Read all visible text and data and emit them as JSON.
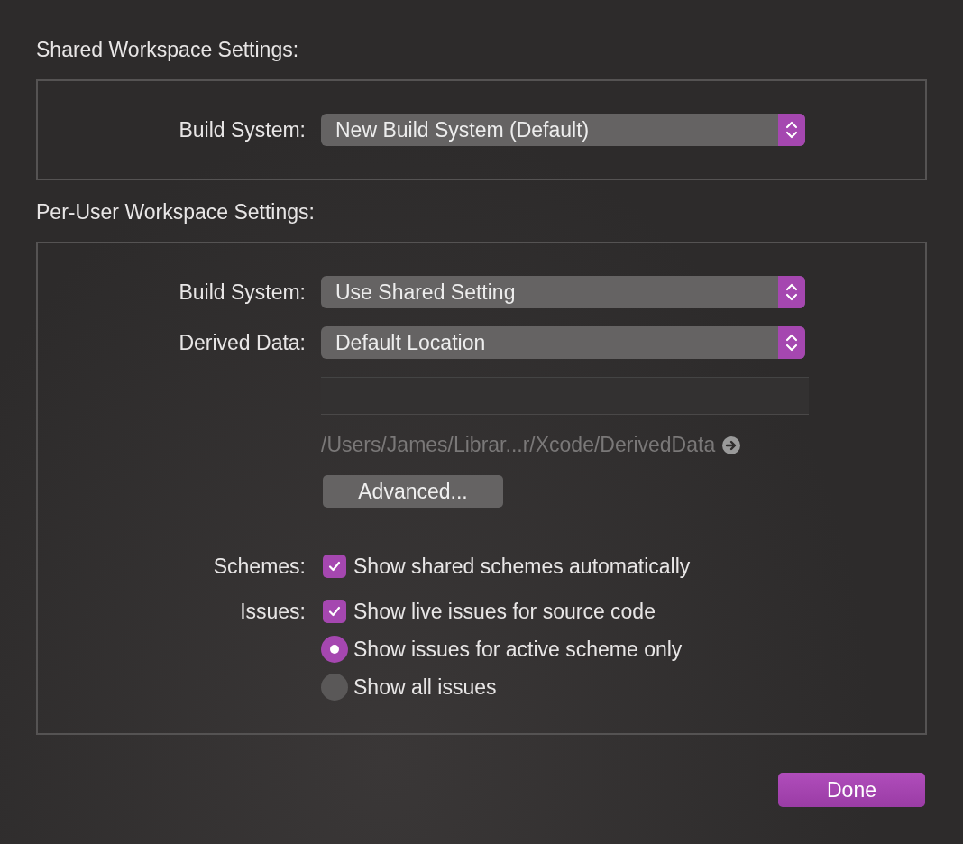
{
  "sections": [
    {
      "title": "Shared Workspace Settings:",
      "rows": [
        {
          "kind": "popup",
          "label": "Build System:",
          "value": "New Build System (Default)"
        }
      ]
    },
    {
      "title": "Per-User Workspace Settings:",
      "rows": [
        {
          "kind": "popup",
          "label": "Build System:",
          "value": "Use Shared Setting"
        },
        {
          "kind": "popup",
          "label": "Derived Data:",
          "value": "Default Location"
        },
        {
          "kind": "field"
        },
        {
          "kind": "path",
          "value": "/Users/James/Librar...r/Xcode/DerivedData"
        },
        {
          "kind": "button",
          "value": "Advanced..."
        }
      ],
      "options": [
        {
          "kind": "checkbox",
          "label": "Schemes:",
          "text": "Show shared schemes automatically",
          "checked": true
        },
        {
          "kind": "checkbox",
          "label": "Issues:",
          "text": "Show live issues for source code",
          "checked": true
        },
        {
          "kind": "radio",
          "text": "Show issues for active scheme only",
          "selected": true
        },
        {
          "kind": "radio",
          "text": "Show all issues",
          "selected": false
        }
      ]
    }
  ],
  "done_button": "Done"
}
